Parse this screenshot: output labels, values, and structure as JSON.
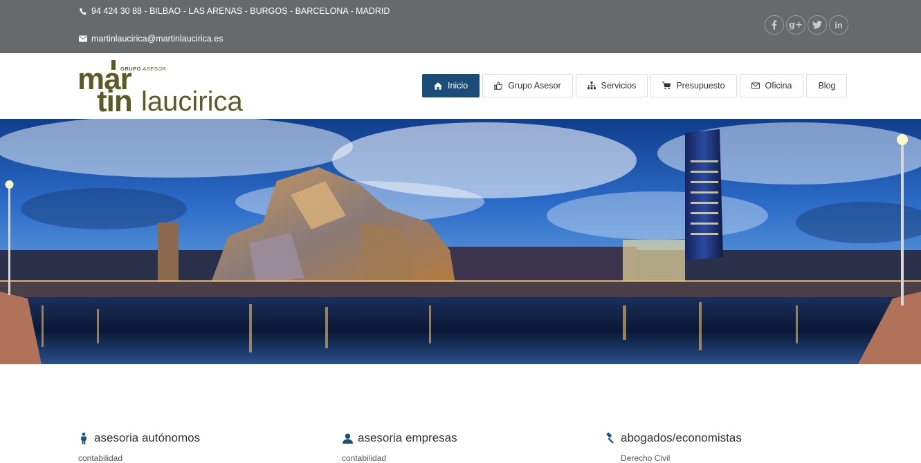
{
  "topbar": {
    "phone_line": "94 424 30 88 - BILBAO - LAS ARENAS - BURGOS - BARCELONA - MADRID",
    "email": "martinlaucirica@martinlaucirica.es",
    "phone_icon": "phone-icon",
    "email_icon": "envelope-icon",
    "socials": [
      {
        "label": "f",
        "icon": "facebook-icon"
      },
      {
        "label": "g+",
        "icon": "google-plus-icon"
      },
      {
        "label": "t",
        "icon": "twitter-icon"
      },
      {
        "label": "in",
        "icon": "linkedin-icon"
      }
    ]
  },
  "logo": {
    "grupo_bold": "GRUPO",
    "grupo_rest": " ASESOR",
    "mar": "mar",
    "tin": "tin",
    "laucirica": "laucirica",
    "color": "#5b5a24"
  },
  "nav": {
    "items": [
      {
        "label": "Inicio",
        "icon": "home-icon",
        "active": true
      },
      {
        "label": "Grupo Asesor",
        "icon": "thumbs-up-icon",
        "active": false
      },
      {
        "label": "Servicios",
        "icon": "sitemap-icon",
        "active": false
      },
      {
        "label": "Presupuesto",
        "icon": "cart-icon",
        "active": false
      },
      {
        "label": "Oficina",
        "icon": "envelope-icon",
        "active": false
      },
      {
        "label": "Blog",
        "icon": "",
        "active": false
      }
    ],
    "active_color": "#1b4d78"
  },
  "hero": {
    "alt": "Bilbao panorama"
  },
  "services": [
    {
      "title": "asesoria autónomos",
      "icon": "person-icon",
      "sub": "contabilidad"
    },
    {
      "title": "asesoria empresas",
      "icon": "user-icon",
      "sub": "contabilidad"
    },
    {
      "title": "abogados/economistas",
      "icon": "gavel-icon",
      "sub": "Derecho Civil"
    }
  ],
  "colors": {
    "topbar": "#666a6d",
    "accent": "#1b4d78"
  }
}
